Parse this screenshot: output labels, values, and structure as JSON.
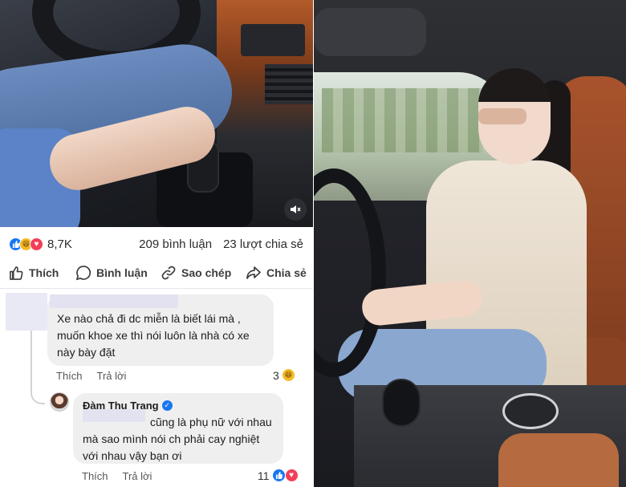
{
  "post": {
    "reaction_count": "8,7K",
    "comments_count": "209 bình luận",
    "shares_count": "23 lượt chia sẻ"
  },
  "actions": {
    "like": "Thích",
    "comment": "Bình luận",
    "copy": "Sao chép",
    "share": "Chia sẻ"
  },
  "comment1": {
    "text": "Xe nào chả đi dc miễn là biết lái mà , muốn khoe xe thì nói luôn là nhà có xe này bày đặt",
    "like": "Thích",
    "reply": "Trả lời",
    "reactions": "3"
  },
  "comment2": {
    "author": "Đàm Thu Trang",
    "text": "cũng là phụ nữ với nhau mà sao mình nói ch phải cay nghiệt với nhau vậy bạn ơi",
    "like": "Thích",
    "reply": "Trả lời",
    "reactions": "11"
  },
  "colors": {
    "like_blue": "#1877f2",
    "love_red": "#f33e58",
    "haha_yellow": "#f7b928"
  },
  "icons": [
    "mute-icon",
    "like-icon",
    "comment-icon",
    "link-icon",
    "share-icon",
    "verified-icon"
  ]
}
